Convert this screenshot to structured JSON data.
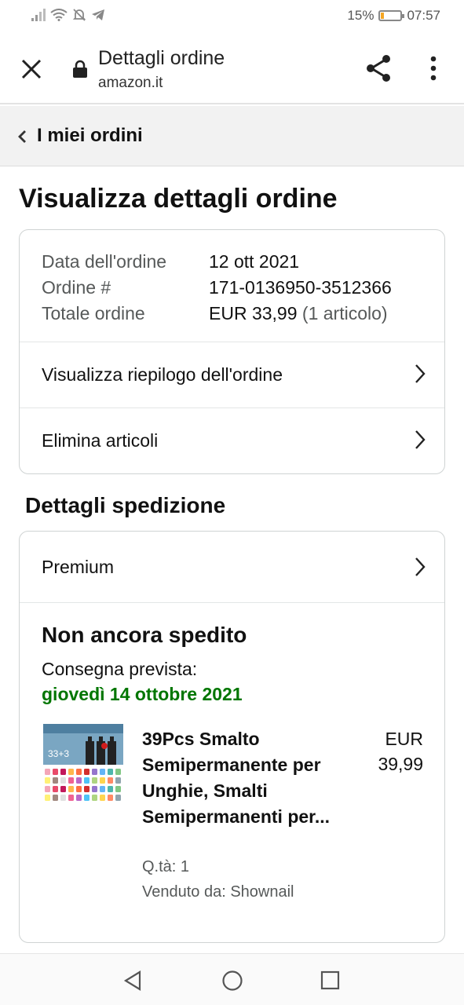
{
  "status_bar": {
    "battery": "15%",
    "battery_level": 0.15,
    "time": "07:57"
  },
  "browser": {
    "title": "Dettagli ordine",
    "url": "amazon.it"
  },
  "back_nav": {
    "label": "I miei ordini"
  },
  "page_title": "Visualizza dettagli ordine",
  "order_info": {
    "date_label": "Data dell'ordine",
    "date_value": "12 ott 2021",
    "number_label": "Ordine #",
    "number_value": "171-0136950-3512366",
    "total_label": "Totale ordine",
    "total_value": "EUR 33,99",
    "total_items": "(1 articolo)"
  },
  "order_links": {
    "summary": "Visualizza riepilogo dell'ordine",
    "delete_items": "Elimina articoli"
  },
  "shipping": {
    "section_title": "Dettagli spedizione",
    "method": "Premium",
    "status": "Non ancora spedito",
    "delivery_label": "Consegna prevista:",
    "delivery_date": "giovedì 14 ottobre 2021",
    "product": {
      "title": "39Pcs Smalto Semipermanente per Unghie, Smalti Semipermanenti per...",
      "price": "EUR 39,99",
      "qty": "Q.tà: 1",
      "seller": "Venduto da: Shownail",
      "image_text": "33+3"
    }
  },
  "colors": {
    "delivery_green": "#007600",
    "secondary_text": "#565959",
    "border": "#cfd3d3"
  }
}
